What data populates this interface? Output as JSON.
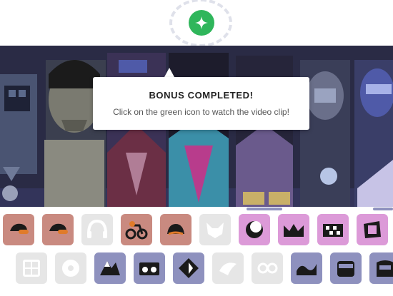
{
  "bonus": {
    "icon": "sparkle-icon",
    "color": "#2fb65b"
  },
  "tooltip": {
    "title": "BONUS COMPLETED!",
    "message": "Click on the green icon to watch the video clip!"
  },
  "colors": {
    "stage": "#2a2b45",
    "red_tile": "#c98a80",
    "grey_tile": "#e6e6e6",
    "pink_tile": "#dc9ad8",
    "blue_tile": "#8e91be"
  },
  "row1": [
    {
      "icon": "cap-icon",
      "state": "red"
    },
    {
      "icon": "cap-icon",
      "state": "red"
    },
    {
      "icon": "headphones-icon",
      "state": "grey"
    },
    {
      "icon": "bike-icon",
      "state": "red"
    },
    {
      "icon": "hat-icon",
      "state": "red"
    },
    {
      "icon": "fox-icon",
      "state": "grey"
    },
    {
      "icon": "moon-icon",
      "state": "pink"
    },
    {
      "icon": "crown-icon",
      "state": "pink"
    },
    {
      "icon": "checker-icon",
      "state": "pink"
    },
    {
      "icon": "box-icon",
      "state": "pink"
    }
  ],
  "row2": [
    {
      "icon": "window-icon",
      "state": "grey"
    },
    {
      "icon": "pokeball-icon",
      "state": "grey"
    },
    {
      "icon": "mountain-icon",
      "state": "blue"
    },
    {
      "icon": "radio-icon",
      "state": "blue"
    },
    {
      "icon": "diamond-icon",
      "state": "blue"
    },
    {
      "icon": "bird-icon",
      "state": "grey"
    },
    {
      "icon": "circles-icon",
      "state": "grey"
    },
    {
      "icon": "wave-icon",
      "state": "blue"
    },
    {
      "icon": "mask-icon",
      "state": "blue"
    },
    {
      "icon": "visor-icon",
      "state": "blue"
    }
  ]
}
